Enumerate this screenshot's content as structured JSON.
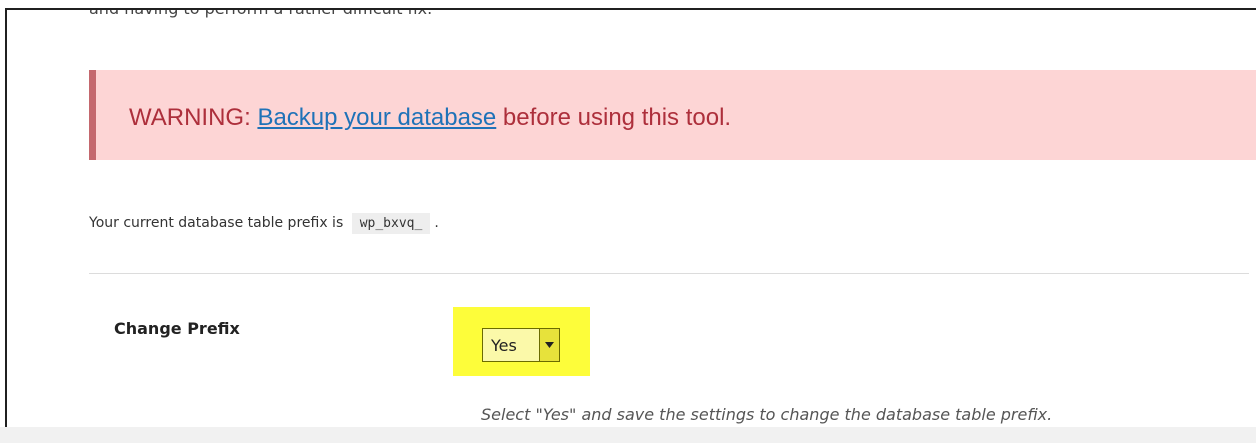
{
  "cutoff_text": "and having to perform a rather difficult fix.",
  "warning": {
    "prefix": "WARNING: ",
    "link_text": "Backup your database",
    "suffix": " before using this tool."
  },
  "prefix_info": {
    "text_before": "Your current database table prefix is",
    "code": "wp_bxvq_",
    "text_after": "."
  },
  "change_prefix": {
    "label": "Change Prefix",
    "selected_value": "Yes",
    "description": "Select \"Yes\" and save the settings to change the database table prefix."
  },
  "colors": {
    "warning_bg": "#fdd5d5",
    "warning_border": "#c4686e",
    "warning_text": "#ad2f3b",
    "link": "#1f72b8",
    "highlight": "#fdfd3a"
  }
}
